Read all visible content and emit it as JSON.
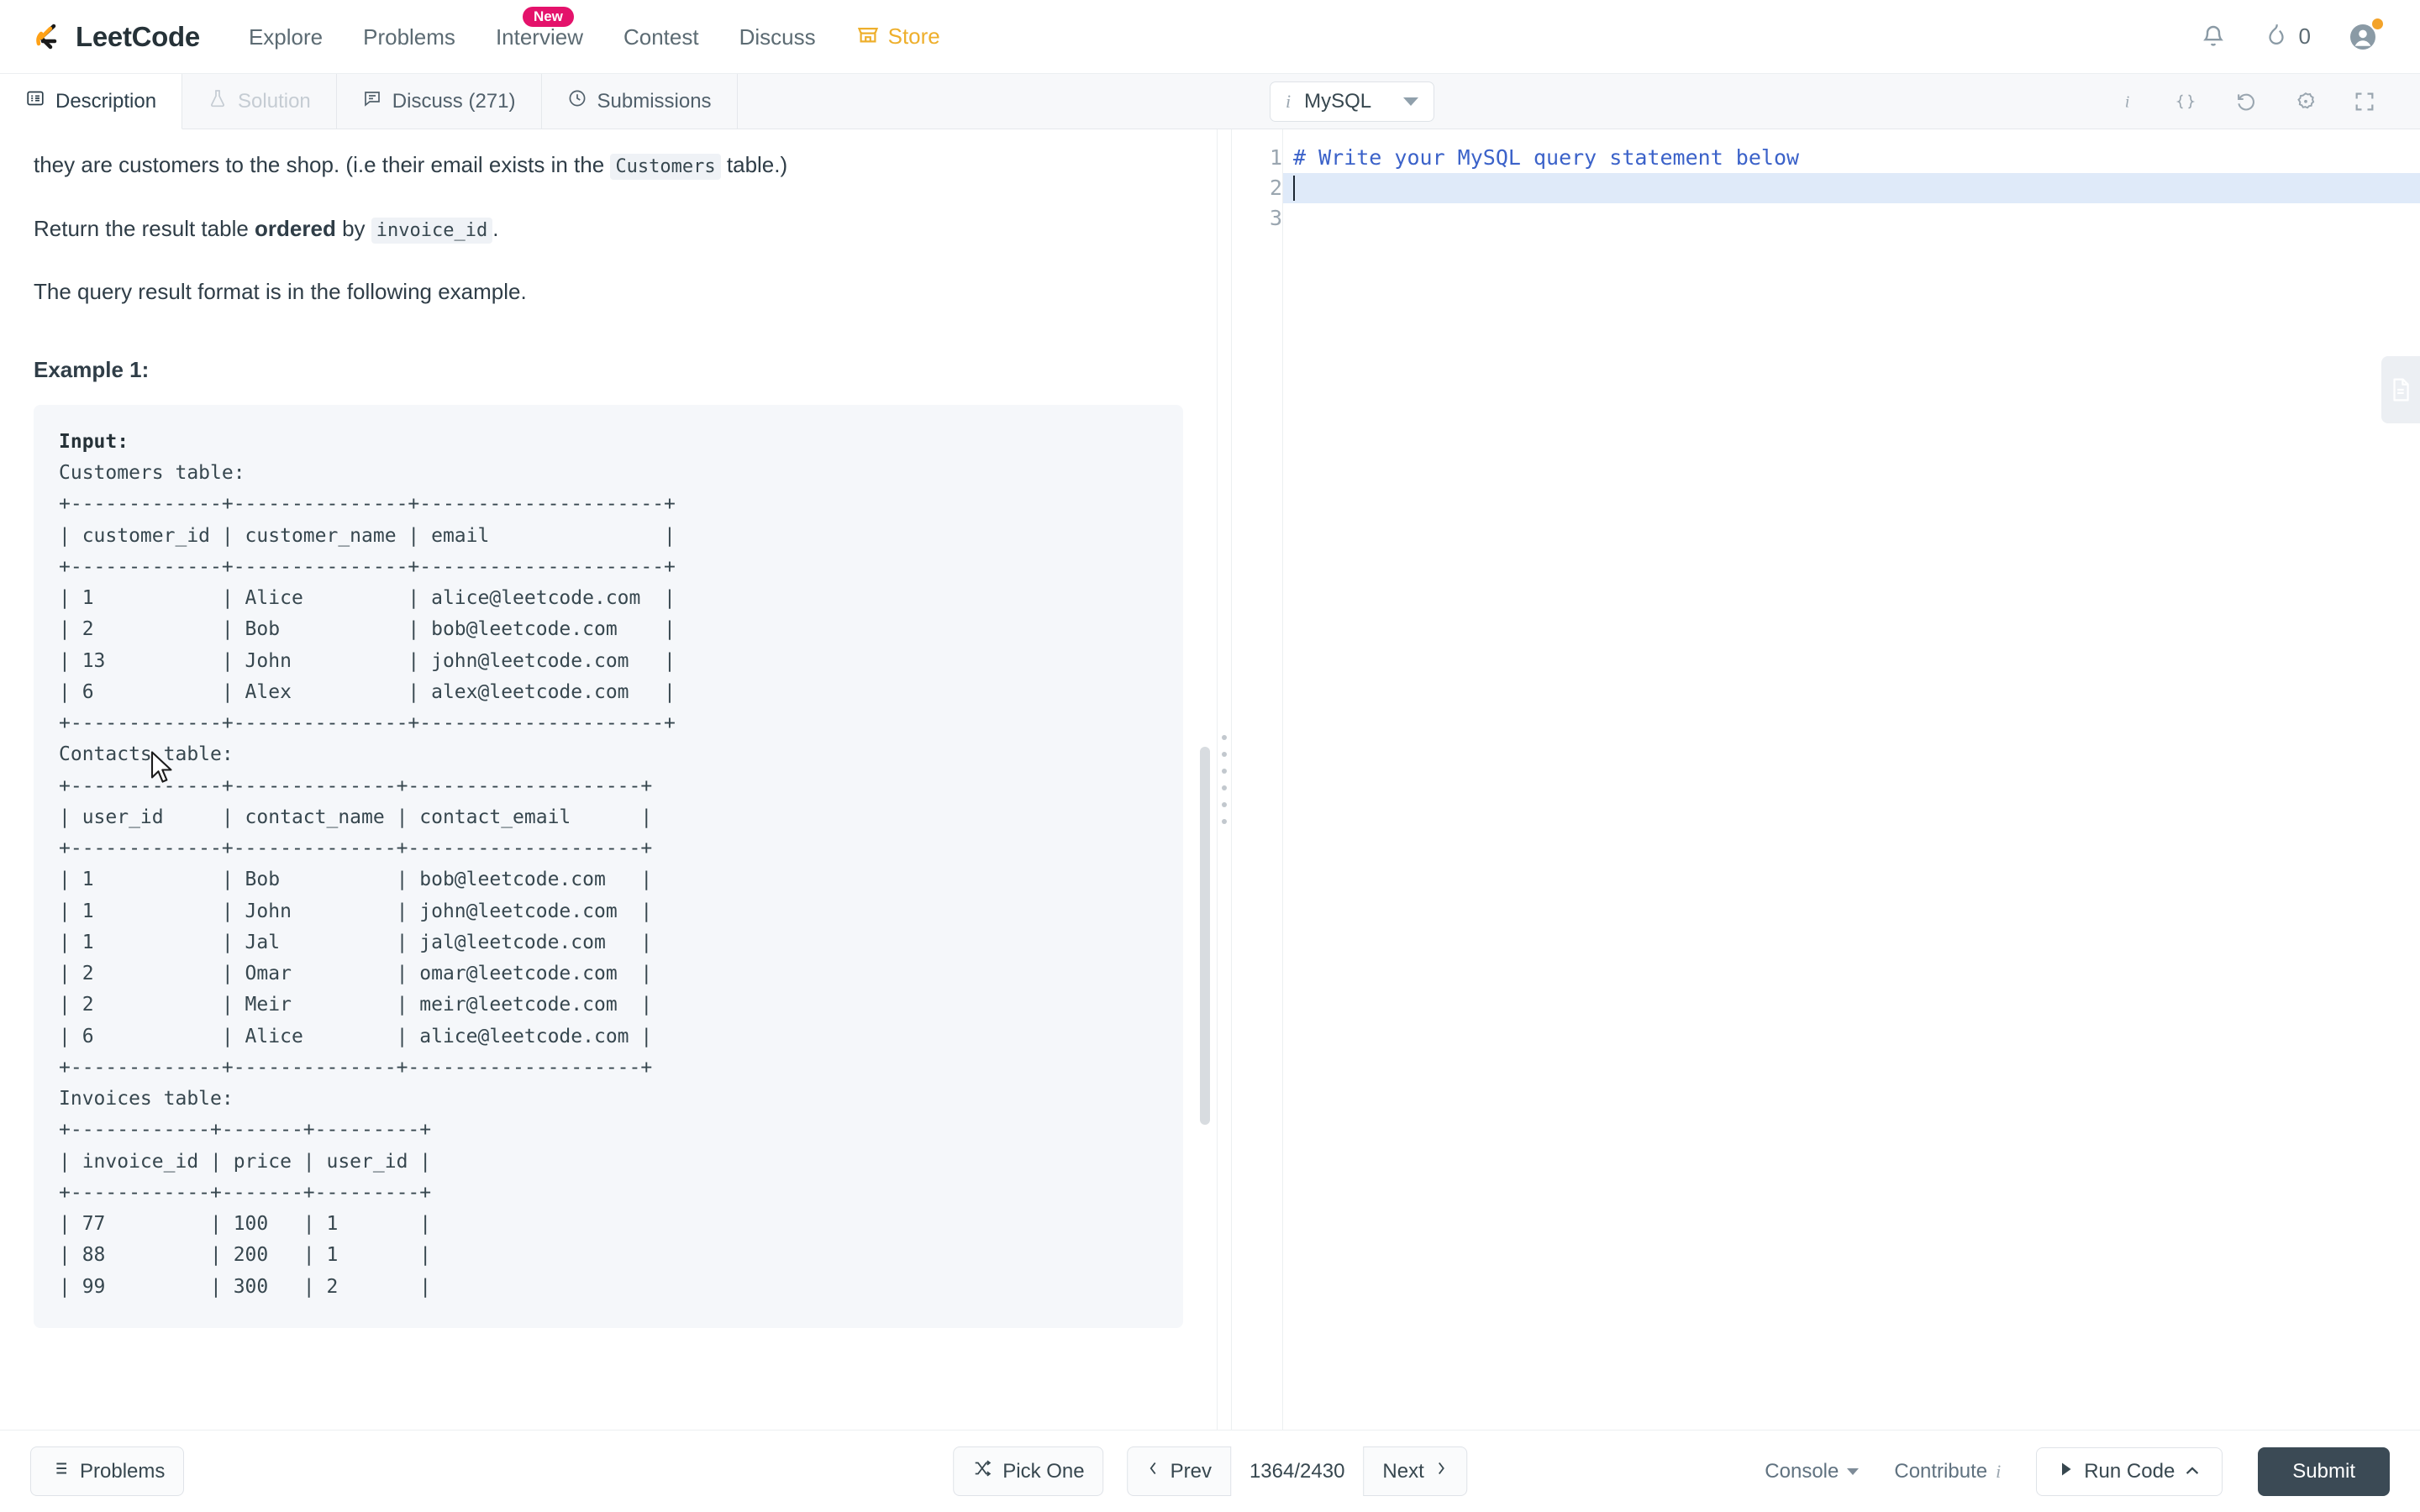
{
  "navbar": {
    "brand": "LeetCode",
    "links": [
      {
        "label": "Explore"
      },
      {
        "label": "Problems"
      },
      {
        "label": "Interview",
        "badge": "New"
      },
      {
        "label": "Contest"
      },
      {
        "label": "Discuss"
      },
      {
        "label": "Store"
      }
    ],
    "streak_count": "0",
    "bell_icon": "notification-bell-icon",
    "streak_icon": "flame-icon",
    "avatar_icon": "user-avatar-icon"
  },
  "tabs": [
    {
      "label": "Description",
      "icon": "description-icon",
      "state": "active"
    },
    {
      "label": "Solution",
      "icon": "flask-icon",
      "state": "disabled"
    },
    {
      "label": "Discuss (271)",
      "icon": "comment-icon",
      "state": "normal"
    },
    {
      "label": "Submissions",
      "icon": "clock-icon",
      "state": "normal"
    }
  ],
  "editor_toolbar": {
    "language": "MySQL",
    "lang_info_icon": "info-italic-icon",
    "tools": [
      {
        "name": "info-icon",
        "glyph": "i"
      },
      {
        "name": "format-braces-icon",
        "glyph": "{}"
      },
      {
        "name": "reset-undo-icon",
        "glyph": "↺"
      },
      {
        "name": "settings-gear-icon",
        "glyph": "⚙"
      },
      {
        "name": "fullscreen-icon",
        "glyph": "⛶"
      }
    ]
  },
  "description": {
    "paragraph_1_pre": "they are customers to the shop. (i.e their email exists in the ",
    "paragraph_1_code": "Customers",
    "paragraph_1_post": " table.)",
    "paragraph_2_pre": "Return the result table ",
    "paragraph_2_bold": "ordered",
    "paragraph_2_mid": " by ",
    "paragraph_2_code": "invoice_id",
    "paragraph_2_post": ".",
    "paragraph_3": "The query result format is in the following example.",
    "example_title": "Example 1:",
    "example_block": "Input:\nCustomers table:\n+-------------+---------------+---------------------+\n| customer_id | customer_name | email               |\n+-------------+---------------+---------------------+\n| 1           | Alice         | alice@leetcode.com  |\n| 2           | Bob           | bob@leetcode.com    |\n| 13          | John          | john@leetcode.com   |\n| 6           | Alex          | alex@leetcode.com   |\n+-------------+---------------+---------------------+\nContacts table:\n+-------------+--------------+--------------------+\n| user_id     | contact_name | contact_email      |\n+-------------+--------------+--------------------+\n| 1           | Bob          | bob@leetcode.com   |\n| 1           | John         | john@leetcode.com  |\n| 1           | Jal          | jal@leetcode.com   |\n| 2           | Omar         | omar@leetcode.com  |\n| 2           | Meir         | meir@leetcode.com  |\n| 6           | Alice        | alice@leetcode.com |\n+-------------+--------------+--------------------+\nInvoices table:\n+------------+-------+---------+\n| invoice_id | price | user_id |\n+------------+-------+---------+\n| 77         | 100   | 1       |\n| 88         | 200   | 1       |\n| 99         | 300   | 2       |",
    "example_input_label": "Input:"
  },
  "editor": {
    "lines": [
      {
        "num": "1",
        "text": "# Write your MySQL query statement below",
        "type": "comment"
      },
      {
        "num": "2",
        "text": "",
        "type": "active"
      },
      {
        "num": "3",
        "text": "",
        "type": "plain"
      }
    ],
    "note_tab_icon": "note-document-icon"
  },
  "bottombar": {
    "problems_label": "Problems",
    "problems_icon": "list-icon",
    "pick_one_label": "Pick One",
    "pick_one_icon": "shuffle-icon",
    "prev_label": "Prev",
    "next_label": "Next",
    "page_indicator": "1364/2430",
    "console_label": "Console",
    "contribute_label": "Contribute",
    "contribute_icon": "info-italic-icon",
    "run_code_label": "Run Code",
    "run_icon": "play-icon",
    "submit_label": "Submit"
  },
  "colors": {
    "brand_orange": "#ffa116",
    "store_gold": "#eeaf2c",
    "badge_pink": "#e4126b",
    "submit_dark": "#3b4a55",
    "comment_blue": "#3b62c9",
    "active_line": "#dfeaf9"
  }
}
